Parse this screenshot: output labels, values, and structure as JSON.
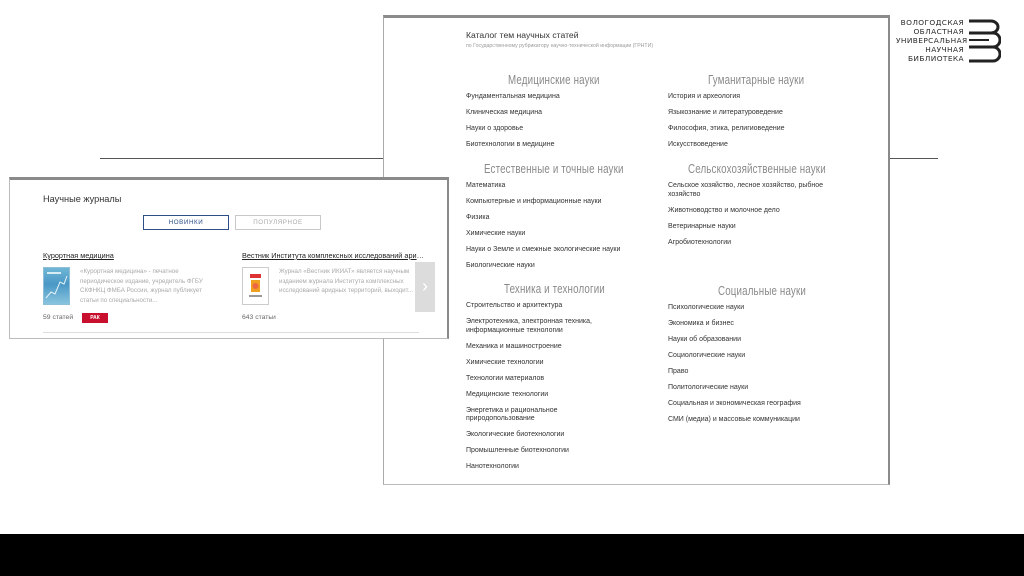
{
  "logo": {
    "lines": [
      "ВОЛОГОДСКАЯ",
      "ОБЛАСТНАЯ",
      "УНИВЕРСАЛЬНАЯ",
      "НАУЧНАЯ",
      "БИБЛИОТЕКА"
    ]
  },
  "catalog": {
    "title": "Каталог тем научных статей",
    "subtitle": "по Государственному рубрикатору научно-технической информации (ГРНТИ)",
    "sections": [
      {
        "heading": "Медицинские науки",
        "items": [
          "Фундаментальная медицина",
          "Клиническая медицина",
          "Науки о здоровье",
          "Биотехнологии в медицине"
        ]
      },
      {
        "heading": "Естественные и точные науки",
        "items": [
          "Математика",
          "Компьютерные и информационные науки",
          "Физика",
          "Химические науки",
          "Науки о Земле и смежные экологические науки",
          "Биологические науки"
        ]
      },
      {
        "heading": "Техника и технологии",
        "items": [
          "Строительство и архитектура",
          "Электротехника, электронная техника, информационные технологии",
          "Механика и машиностроение",
          "Химические технологии",
          "Технологии материалов",
          "Медицинские технологии",
          "Энергетика и рациональное природопользование",
          "Экологические биотехнологии",
          "Промышленные биотехнологии",
          "Нанотехнологии"
        ]
      },
      {
        "heading": "Гуманитарные науки",
        "items": [
          "История и археология",
          "Языкознание и литературоведение",
          "Философия, этика, религиоведение",
          "Искусствоведение"
        ]
      },
      {
        "heading": "Сельскохозяйственные науки",
        "items": [
          "Сельское хозяйство, лесное хозяйство, рыбное хозяйство",
          "Животноводство и молочное дело",
          "Ветеринарные науки",
          "Агробиотехнологии"
        ]
      },
      {
        "heading": "Социальные науки",
        "items": [
          "Психологические науки",
          "Экономика и бизнес",
          "Науки об образовании",
          "Социологические науки",
          "Право",
          "Политологические науки",
          "Социальная и экономическая география",
          "СМИ (медиа) и массовые коммуникации"
        ]
      }
    ]
  },
  "journals": {
    "title": "Научные журналы",
    "tabs": [
      {
        "label": "НОВИНКИ"
      },
      {
        "label": "ПОПУЛЯРНОЕ"
      }
    ],
    "cards": [
      {
        "name": "Курортная медицина",
        "description": "«Курортная медицина» - печатное периодическое издание, учредитель ФГБУ СКФНКЦ ФМБА России, журнал публикует статьи по специальности...",
        "count": "59 статей",
        "badge": "РАК"
      },
      {
        "name": "Вестник Института комплексных исследований аридных территорий",
        "description": "Журнал «Вестник ИКИАТ» является научным изданием журнала Института комплексных исследований аридных территорий, выходит...",
        "count": "643 статьи"
      }
    ],
    "next_icon": "chevron-right-icon"
  },
  "colors": {
    "accent_blue": "#2d4e86",
    "badge_red": "#c8102e"
  }
}
